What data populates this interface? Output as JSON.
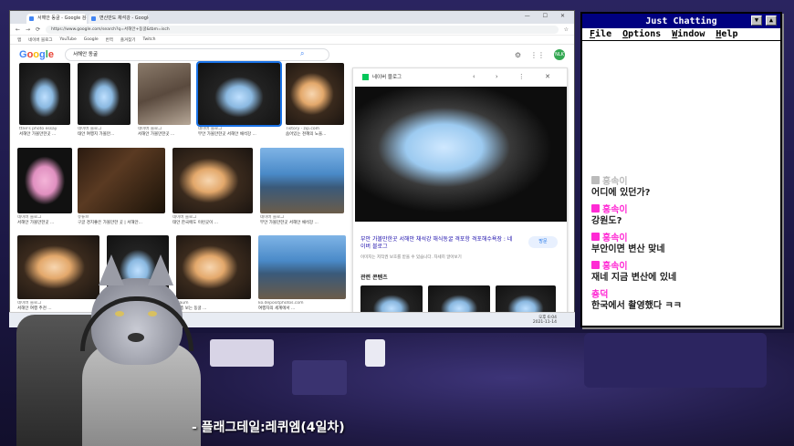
{
  "browser": {
    "tabs": [
      "서해안 동굴 - Google 검색",
      "변산반도 채석강 - Google 검색"
    ],
    "url": "https://www.google.com/search?q=서해안+동굴&tbm=isch",
    "bookmarks": [
      "앱",
      "네이버 블로그",
      "YouTube",
      "Google",
      "번역",
      "즐겨찾기",
      "Twitch"
    ],
    "search_query": "서해안 동굴",
    "avatar_initial": "NLK",
    "results": [
      {
        "title": "서해안 가볼만한곳 ...",
        "source": "ttne's photo essay"
      },
      {
        "title": "태안 여행지 가볼만...",
        "source": "네이버 블로그"
      },
      {
        "title": "서해안 가볼만한곳 ...",
        "source": "네이버 블로그"
      },
      {
        "title": "부안 가볼만한곳 서해안 채석강 ...",
        "source": "네이버 블로그"
      },
      {
        "title": "숨어있는 천혜의 노을...",
        "source": "Tistory · zip.com"
      },
      {
        "title": "서해안 가볼만한곳 ...",
        "source": "네이버 블로그"
      },
      {
        "title": "구글 경치좋은 가볼만한 곳 | 서해안...",
        "source": "유튜브"
      },
      {
        "title": "태안 한국에도 이런곳이 ...",
        "source": "네이버 블로그"
      },
      {
        "title": "부안 가볼만한곳 서해안 채석강 ...",
        "source": "네이버 블로그"
      },
      {
        "title": "서해안 여행 추천 ...",
        "source": "네이버 블로그"
      },
      {
        "title": "일층 보는 동굴 ...",
        "source": "Daum"
      },
      {
        "title": "여행자의 세계에서 ...",
        "source": "ko.depositphotos.com"
      }
    ],
    "preview": {
      "source": "네이버 블로그",
      "title": "부안 가볼만한곳 서해안 채석강 해식동굴 격포항 격포해수욕장 : 네이버 블로그",
      "subtitle": "이미지는 저작권 보호를 받을 수 있습니다.  자세히 알아보기",
      "visit_label": "방문",
      "related_label": "관련 콘텐츠"
    },
    "clock": "오후 6:04\n2021-11-14"
  },
  "chat": {
    "title": "Just Chatting",
    "menu": [
      "File",
      "Options",
      "Window",
      "Help"
    ],
    "messages": [
      {
        "name": "홍속이",
        "text": "어디에 있던가?",
        "badge": "gray"
      },
      {
        "name": "홍속이",
        "text": "강원도?",
        "badge": "pink"
      },
      {
        "name": "홍속이",
        "text": "부안이면 변산 맞네",
        "badge": "pink"
      },
      {
        "name": "홍속이",
        "text": "재네 지금 변산에 있네",
        "badge": "pink"
      },
      {
        "name": "춍덕",
        "text": "한국에서 촬영했다 ㅋㅋ",
        "badge": "none"
      }
    ]
  },
  "stream": {
    "caption": "- 플래그테일:레퀴엠(4일차)"
  },
  "colors": {
    "chat_title_bg": "#000080",
    "chat_name": "#ff2ad4",
    "room": "#1c1845"
  }
}
